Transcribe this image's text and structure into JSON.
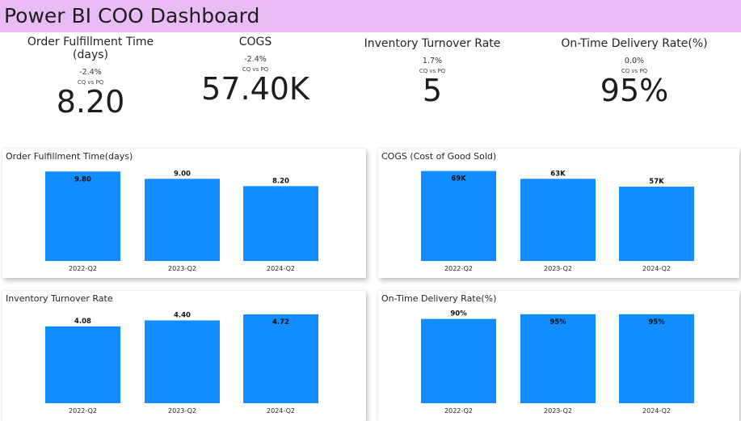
{
  "header": {
    "title": "Power BI COO Dashboard",
    "background": "#e9bcf7"
  },
  "kpis": [
    {
      "title": "Order Fulfillment Time (days)",
      "change": "-2.4%",
      "sub": "CQ vs PQ",
      "value": "8.20"
    },
    {
      "title": "COGS",
      "change": "-2.4%",
      "sub": "CQ vs PQ",
      "value": "57.40K"
    },
    {
      "title": "Inventory Turnover Rate",
      "change": "1.7%",
      "sub": "CQ vs PQ",
      "value": "5"
    },
    {
      "title": "On-Time Delivery Rate(%)",
      "change": "0.0%",
      "sub": "CQ vs PQ",
      "value": "95%"
    }
  ],
  "bar_color": "#118dff",
  "chart_data": [
    {
      "type": "bar",
      "title": "Order Fulfillment Time(days)",
      "categories": [
        "2022-Q2",
        "2023-Q2",
        "2024-Q2"
      ],
      "values": [
        9.8,
        9.0,
        8.2
      ],
      "labels": [
        "9.80",
        "9.00",
        "8.20"
      ],
      "ylim": [
        0,
        10
      ]
    },
    {
      "type": "bar",
      "title": "COGS (Cost of Good Sold)",
      "categories": [
        "2022-Q2",
        "2023-Q2",
        "2024-Q2"
      ],
      "values": [
        69,
        63,
        57
      ],
      "labels": [
        "69K",
        "63K",
        "57K"
      ],
      "ylim": [
        0,
        70
      ]
    },
    {
      "type": "bar",
      "title": "Inventory Turnover Rate",
      "categories": [
        "2022-Q2",
        "2023-Q2",
        "2024-Q2"
      ],
      "values": [
        4.08,
        4.4,
        4.72
      ],
      "labels": [
        "4.08",
        "4.40",
        "4.72"
      ],
      "ylim": [
        0,
        4.85
      ]
    },
    {
      "type": "bar",
      "title": "On-Time Delivery Rate(%)",
      "categories": [
        "2022-Q2",
        "2023-Q2",
        "2024-Q2"
      ],
      "values": [
        90,
        95,
        95
      ],
      "labels": [
        "90%",
        "95%",
        "95%"
      ],
      "ylim": [
        0,
        97.5
      ]
    }
  ]
}
